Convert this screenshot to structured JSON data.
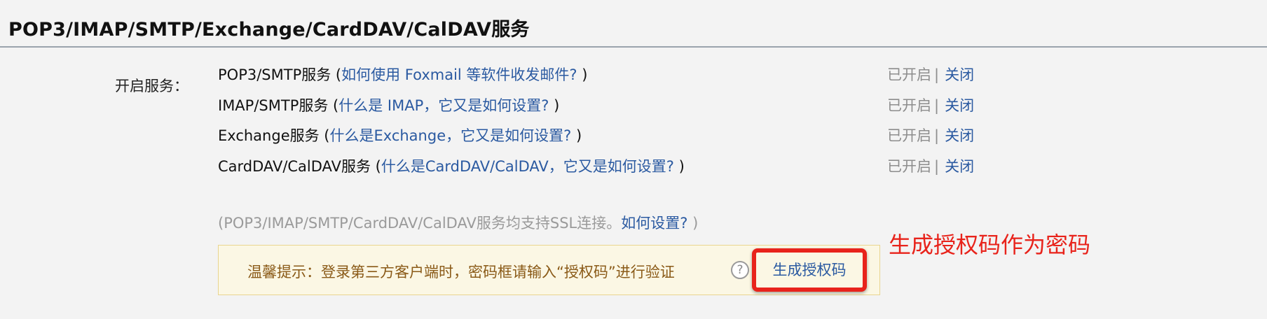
{
  "header": {
    "title": "POP3/IMAP/SMTP/Exchange/CardDAV/CalDAV服务"
  },
  "services_label": "开启服务：",
  "services": [
    {
      "name": "POP3/SMTP服务",
      "open_paren": " (",
      "link": "如何使用 Foxmail 等软件收发邮件?",
      "close_paren": " )",
      "status": "已开启",
      "separator": "|",
      "action": "关闭"
    },
    {
      "name": "IMAP/SMTP服务",
      "open_paren": " (",
      "link": "什么是 IMAP，它又是如何设置?",
      "close_paren": " )",
      "status": "已开启",
      "separator": "|",
      "action": "关闭"
    },
    {
      "name": "Exchange服务",
      "open_paren": " (",
      "link": "什么是Exchange，它又是如何设置?",
      "close_paren": " )",
      "status": "已开启",
      "separator": "|",
      "action": "关闭"
    },
    {
      "name": "CardDAV/CalDAV服务",
      "open_paren": " (",
      "link": "什么是CardDAV/CalDAV，它又是如何设置?",
      "close_paren": " )",
      "status": "已开启",
      "separator": "|",
      "action": "关闭"
    }
  ],
  "ssl_note": {
    "text": "(POP3/IMAP/SMTP/CardDAV/CalDAV服务均支持SSL连接。",
    "link": "如何设置?",
    "close": " )"
  },
  "tip": {
    "text": "温馨提示：登录第三方客户端时，密码框请输入“授权码”进行验证",
    "help_icon": "?",
    "button_label": "生成授权码"
  },
  "annotation": {
    "text": "生成授权码作为密码",
    "color": "#e8231b"
  },
  "colors": {
    "link": "#2b5aa1",
    "tip_text": "#8a5a17",
    "tip_bg": "#fbf7e4",
    "highlight": "#e8231b"
  }
}
